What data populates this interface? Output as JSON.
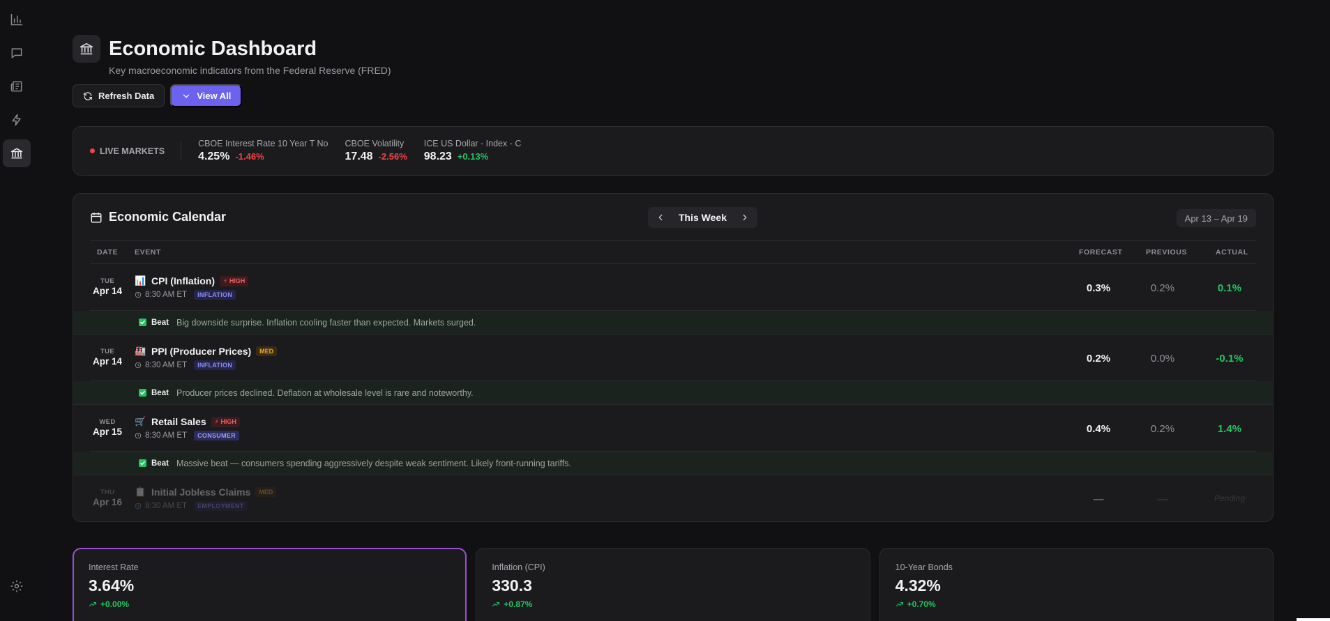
{
  "header": {
    "title": "Economic Dashboard",
    "subtitle": "Key macroeconomic indicators from the Federal Reserve (FRED)",
    "icon": "bank-icon"
  },
  "actions": {
    "refresh_label": "Refresh Data",
    "view_all_label": "View All"
  },
  "ticker": {
    "live_label": "LIVE MARKETS",
    "items": [
      {
        "label": "CBOE Interest Rate 10 Year T No",
        "value": "4.25%",
        "change": "-1.46%",
        "direction": "down"
      },
      {
        "label": "CBOE Volatility",
        "value": "17.48",
        "change": "-2.56%",
        "direction": "down"
      },
      {
        "label": "ICE US Dollar - Index - C",
        "value": "98.23",
        "change": "+0.13%",
        "direction": "up"
      }
    ]
  },
  "calendar": {
    "title": "Economic Calendar",
    "week_label": "This Week",
    "date_range": "Apr 13 – Apr 19",
    "columns": {
      "date": "DATE",
      "event": "EVENT",
      "forecast": "FORECAST",
      "previous": "PREVIOUS",
      "actual": "ACTUAL"
    },
    "events": [
      {
        "dow": "TUE",
        "day": "Apr 14",
        "emoji": "📊",
        "name": "CPI (Inflation)",
        "importance": "⚡ HIGH",
        "time": "8:30 AM ET",
        "category": "INFLATION",
        "forecast": "0.3%",
        "previous": "0.2%",
        "actual": "0.1%",
        "result": "Beat",
        "note": "Big downside surprise. Inflation cooling faster than expected. Markets surged."
      },
      {
        "dow": "TUE",
        "day": "Apr 14",
        "emoji": "🏭",
        "name": "PPI (Producer Prices)",
        "importance": "MED",
        "time": "8:30 AM ET",
        "category": "INFLATION",
        "forecast": "0.2%",
        "previous": "0.0%",
        "actual": "-0.1%",
        "result": "Beat",
        "note": "Producer prices declined. Deflation at wholesale level is rare and noteworthy."
      },
      {
        "dow": "WED",
        "day": "Apr 15",
        "emoji": "🛒",
        "name": "Retail Sales",
        "importance": "⚡ HIGH",
        "time": "8:30 AM ET",
        "category": "CONSUMER",
        "forecast": "0.4%",
        "previous": "0.2%",
        "actual": "1.4%",
        "result": "Beat",
        "note": "Massive beat — consumers spending aggressively despite weak sentiment. Likely front-running tariffs."
      },
      {
        "dow": "THU",
        "day": "Apr 16",
        "emoji": "📋",
        "name": "Initial Jobless Claims",
        "importance": "MED",
        "time": "8:30 AM ET",
        "category": "EMPLOYMENT",
        "forecast": "—",
        "previous": "—",
        "actual": "Pending"
      }
    ]
  },
  "stats": [
    {
      "label": "Interest Rate",
      "value": "3.64%",
      "change": "+0.00%"
    },
    {
      "label": "Inflation (CPI)",
      "value": "330.3",
      "change": "+0.87%"
    },
    {
      "label": "10-Year Bonds",
      "value": "4.32%",
      "change": "+0.70%"
    }
  ],
  "colors": {
    "accent": "#6b63f0",
    "positive": "#22c55e",
    "negative": "#ef4444",
    "selected_border": "#9b4ed6"
  }
}
